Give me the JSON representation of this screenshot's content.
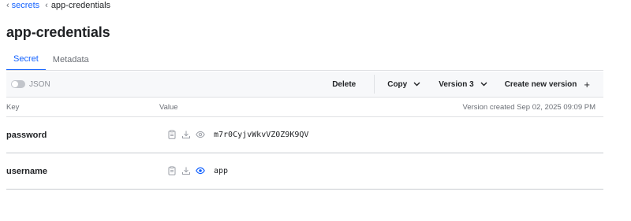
{
  "breadcrumb": {
    "items": [
      {
        "label": "secrets"
      },
      {
        "label": "app-credentials"
      }
    ]
  },
  "page": {
    "title": "app-credentials"
  },
  "tabs": [
    {
      "label": "Secret",
      "active": true
    },
    {
      "label": "Metadata",
      "active": false
    }
  ],
  "toolbar": {
    "json_toggle_label": "JSON",
    "json_toggle_on": false,
    "delete_label": "Delete",
    "copy_label": "Copy",
    "version_label": "Version 3",
    "create_label": "Create new version"
  },
  "table": {
    "columns": {
      "key": "Key",
      "value": "Value"
    },
    "version_info": "Version created Sep 02, 2025 09:09 PM",
    "rows": [
      {
        "key": "password",
        "value": "m7r0CyjvWkvVZ0Z9K9QV",
        "masked": false,
        "icons": [
          "clipboard-icon",
          "download-icon",
          "eye-icon"
        ]
      },
      {
        "key": "username",
        "value": "app",
        "masked": false,
        "icons": [
          "clipboard-icon",
          "download-icon",
          "eye-icon"
        ]
      }
    ]
  },
  "colors": {
    "accent": "#1563ff",
    "text": "#1f2124",
    "muted": "#6b6f76",
    "border": "#dfe1e4",
    "toolbar_bg": "#f7f8fa"
  }
}
